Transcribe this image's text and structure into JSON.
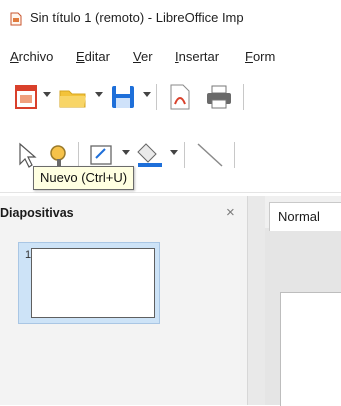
{
  "window": {
    "title": "Sin título 1 (remoto) - LibreOffice Imp"
  },
  "menu": {
    "items": [
      {
        "mnemonic": "A",
        "rest": "rchivo"
      },
      {
        "mnemonic": "E",
        "rest": "ditar"
      },
      {
        "mnemonic": "V",
        "rest": "er"
      },
      {
        "mnemonic": "I",
        "rest": "nsertar"
      },
      {
        "mnemonic": "F",
        "rest": "orm"
      }
    ]
  },
  "toolbar_main": {
    "icons": [
      "new-document-icon",
      "open-folder-icon",
      "save-icon",
      "export-pdf-icon",
      "print-icon"
    ]
  },
  "toolbar_drawing": {
    "icons": [
      "select-pointer-icon",
      "zoom-icon",
      "text-box-icon",
      "fill-icon",
      "line-icon"
    ]
  },
  "tooltip": {
    "text": "Nuevo (Ctrl+U)"
  },
  "slides_panel": {
    "title": "Diapositivas",
    "close_glyph": "×",
    "slides": [
      {
        "number": "1"
      }
    ]
  },
  "view_tabs": {
    "active": "Normal"
  },
  "colors": {
    "selection": "#cde3f7",
    "save_blue": "#1e6fd9",
    "folder_yellow": "#f3c33a",
    "new_doc_red": "#d9402b",
    "tooltip_bg": "#ffffe1"
  }
}
